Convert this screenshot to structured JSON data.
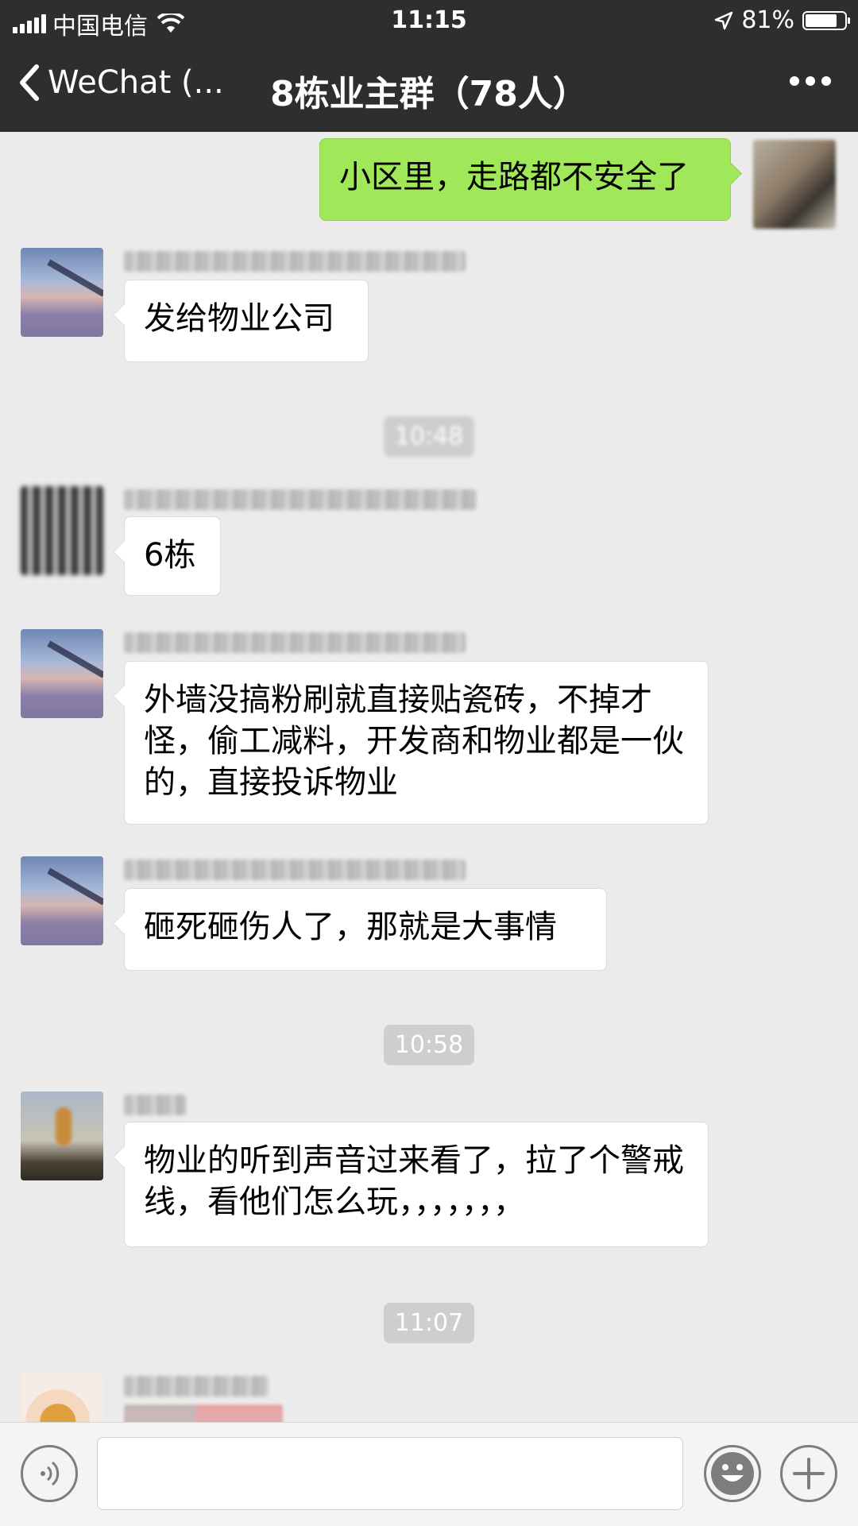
{
  "status_bar": {
    "carrier": "中国电信",
    "time": "11:15",
    "battery_text": "81%",
    "battery_level": 0.81
  },
  "nav": {
    "back_label": "WeChat (...",
    "title": "8栋业主群（78人）"
  },
  "messages": [
    {
      "side": "right",
      "text": "小区里，走路都不安全了",
      "avatar": "self"
    },
    {
      "side": "left",
      "text": "发给物业公司",
      "avatar": "sky"
    },
    {
      "type": "timestamp",
      "text": "10:48",
      "blurred": true
    },
    {
      "side": "left",
      "text": "6栋",
      "avatar": "qr"
    },
    {
      "side": "left",
      "text": "外墙没搞粉刷就直接贴瓷砖，不掉才怪，偷工减料，开发商和物业都是一伙的，直接投诉物业",
      "avatar": "sky"
    },
    {
      "side": "left",
      "text": "砸死砸伤人了，那就是大事情",
      "avatar": "sky"
    },
    {
      "type": "timestamp",
      "text": "10:58"
    },
    {
      "side": "left",
      "text": "物业的听到声音过来看了，拉了个警戒线，看他们怎么玩，，，，，，，",
      "avatar": "person"
    },
    {
      "type": "timestamp",
      "text": "11:07"
    }
  ],
  "icons": {
    "back": "chevron-left-icon",
    "more": "more-dots-icon",
    "voice": "voice-icon",
    "emoji": "emoji-icon",
    "add": "plus-icon"
  },
  "colors": {
    "header_bg": "#2e2e2e",
    "chat_bg": "#ebebeb",
    "self_bubble": "#a0e75a",
    "other_bubble": "#ffffff",
    "timestamp_bg": "#cecece"
  }
}
